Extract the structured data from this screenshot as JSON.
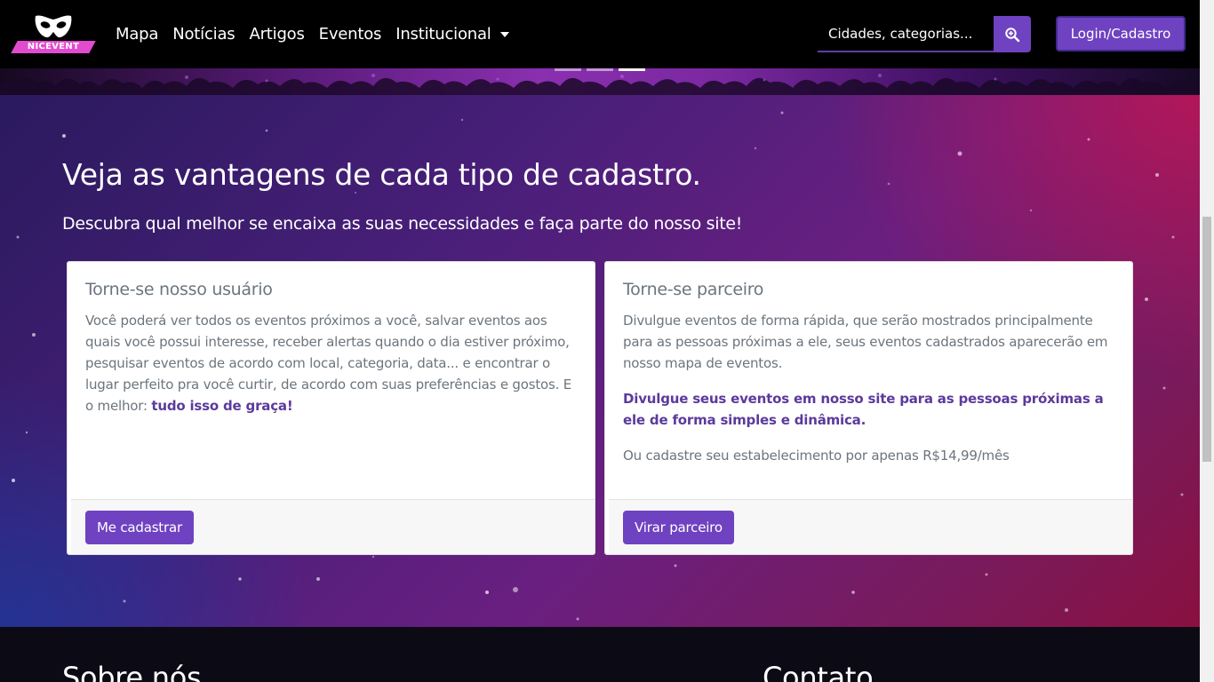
{
  "brand": {
    "logo_text": "NICEVENT",
    "accent_color": "#6f42c1",
    "logo_color": "#e24bd0"
  },
  "nav": {
    "links": [
      "Mapa",
      "Notícias",
      "Artigos",
      "Eventos"
    ],
    "dropdown_label": "Institucional",
    "search_placeholder": "Cidades, categorias...",
    "search_icon": "search-zoom-icon",
    "login_label": "Login/Cadastro"
  },
  "carousel": {
    "slide_count": 3,
    "active_index": 2
  },
  "signup": {
    "title": "Veja as vantagens de cada tipo de cadastro.",
    "subtitle": "Descubra qual melhor se encaixa as suas necessidades e faça parte do nosso site!",
    "user_card": {
      "title": "Torne-se nosso usuário",
      "text": "Você poderá ver todos os eventos próximos a você, salvar eventos aos quais você possui interesse, receber alertas quando o dia estiver próximo, pesquisar eventos de acordo com local, categoria, data... e encontrar o lugar perfeito pra você curtir, de acordo com suas preferências e gostos. E o melhor: ",
      "text_strong": "tudo isso de graça!",
      "button": "Me cadastrar"
    },
    "partner_card": {
      "title": "Torne-se parceiro",
      "text": "Divulgue eventos de forma rápida, que serão mostrados principalmente para as pessoas próximas a ele, seus eventos cadastrados aparecerão em nosso mapa de eventos.",
      "highlight": "Divulgue seus eventos em nosso site para as pessoas próximas a ele de forma simples e dinâmica.",
      "note": "Ou cadastre seu estabelecimento por apenas R$14,99/mês",
      "button": "Virar parceiro"
    }
  },
  "footer": {
    "about_heading": "Sobre nós",
    "contact_heading": "Contato"
  }
}
